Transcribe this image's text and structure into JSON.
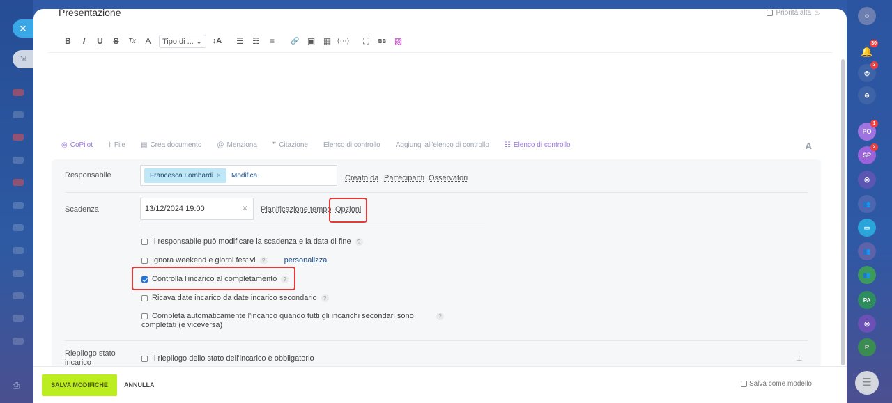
{
  "header": {
    "title": "Presentazione",
    "priority_label": "Priorità alta"
  },
  "editor_toolbar": {
    "font_select": "Tipo di ...",
    "items": [
      "B",
      "I",
      "U",
      "S",
      "Tx",
      "A",
      "↕A",
      "☰",
      "☷",
      "≡",
      "🔗",
      "▣",
      "▦",
      "⟨⋯⟩",
      "⛶",
      "BB"
    ]
  },
  "actions": {
    "copilot": "CoPilot",
    "file": "File",
    "crea_documento": "Crea documento",
    "menziona": "Menziona",
    "citazione": "Citazione",
    "elenco_controllo": "Elenco di controllo",
    "aggiungi_elenco": "Aggiungi all'elenco di controllo",
    "elenco_controllo_2": "Elenco di controllo",
    "font_toggle": "A"
  },
  "responsabile": {
    "label": "Responsabile",
    "person": "Francesca Lombardi",
    "modifica": "Modifica",
    "creato_da": "Creato da",
    "partecipanti": "Partecipanti",
    "osservatori": "Osservatori"
  },
  "scadenza": {
    "label": "Scadenza",
    "value": "13/12/2024 19:00",
    "pianificazione": "Pianificazione tempo",
    "opzioni": "Opzioni"
  },
  "options": [
    {
      "label": "Il responsabile può modificare la scadenza e la data di fine",
      "checked": false
    },
    {
      "label": "Ignora weekend e giorni festivi",
      "checked": false,
      "link": "personalizza"
    },
    {
      "label": "Controlla l'incarico al completamento",
      "checked": true
    },
    {
      "label": "Ricava date incarico da date incarico secondario",
      "checked": false
    },
    {
      "label": "Completa automaticamente l'incarico quando tutti gli incarichi secondari sono",
      "label2": "completati (e viceversa)",
      "checked": false
    }
  ],
  "riepilogo": {
    "label": "Riepilogo stato incarico",
    "option": "Il riepilogo dello stato dell'incarico è obbligatorio"
  },
  "footer": {
    "save": "SALVA MODIFICHE",
    "cancel": "ANNULLA",
    "template": "Salva come modello"
  },
  "rightbar": {
    "badges": [
      "30",
      "3",
      "1",
      "2"
    ],
    "avatars": [
      "PO",
      "SP",
      "PA",
      "P"
    ]
  },
  "colors": {
    "accent_green": "#bbed21",
    "highlight_red": "#e53935",
    "chip_blue": "#bfe7f6",
    "link_blue": "#1b4f8f"
  }
}
